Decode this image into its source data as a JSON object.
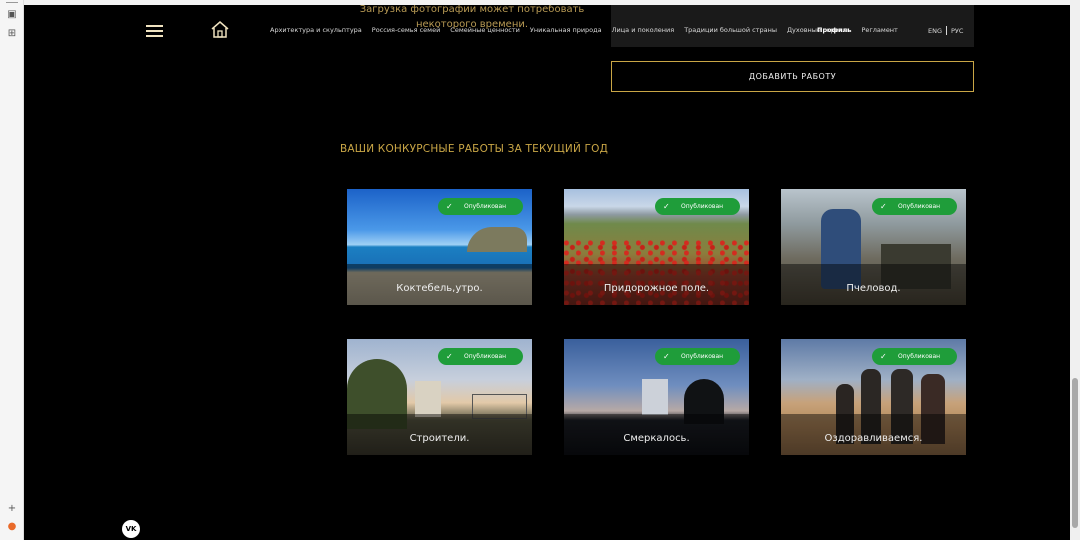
{
  "header": {
    "menu_icon": "hamburger-icon",
    "home_icon": "home-icon",
    "nav_items": [
      "Архитектура и скульптура",
      "Россия-семья семей",
      "Семейные ценности",
      "Уникальная природа",
      "Лица и поколения",
      "Традиции большой страны",
      "Духовные скрепы"
    ],
    "profile": "Профиль",
    "regulations": "Регламент",
    "lang_en": "ENG",
    "lang_ru": "РУС"
  },
  "upload": {
    "note": "Загрузка фотографии может потребовать некоторого времени.",
    "add_button": "ДОБАВИТЬ РАБОТУ"
  },
  "works": {
    "title": "ВАШИ КОНКУРСНЫЕ РАБОТЫ ЗА ТЕКУЩИЙ ГОД",
    "items": [
      {
        "caption": "Коктебель,утро.",
        "status": "Опубликован"
      },
      {
        "caption": "Придорожное поле.",
        "status": "Опубликован"
      },
      {
        "caption": "Пчеловод.",
        "status": "Опубликован"
      },
      {
        "caption": "Строители.",
        "status": "Опубликован"
      },
      {
        "caption": "Смеркалось.",
        "status": "Опубликован"
      },
      {
        "caption": "Оздоравливаемся.",
        "status": "Опубликован"
      }
    ]
  },
  "footer": {
    "vk_label": "VK"
  },
  "colors": {
    "accent_gold": "#c9a646",
    "badge_green": "#1f9d3a",
    "background": "#000000"
  }
}
